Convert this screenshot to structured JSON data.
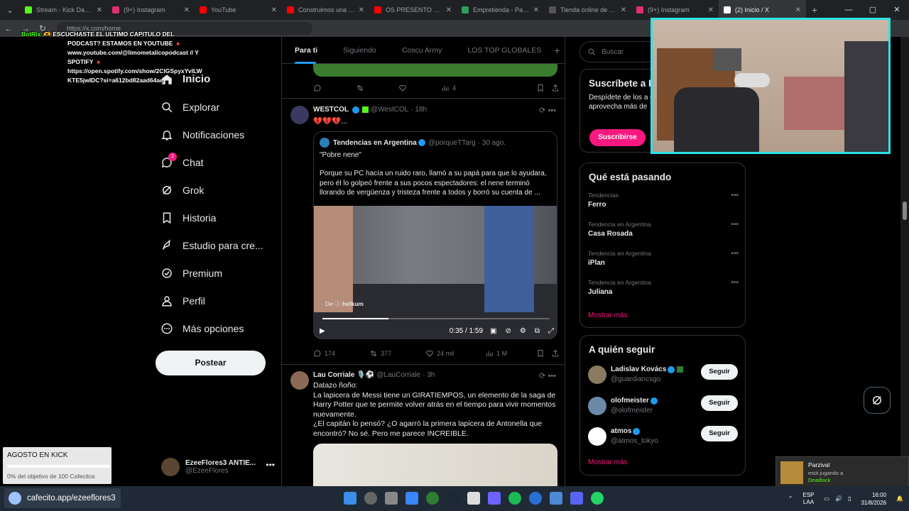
{
  "browser": {
    "tabs": [
      {
        "label": "Stream - Kick Dashboard",
        "color": "#53fc18"
      },
      {
        "label": "(9+) Instagram",
        "color": "#e1306c"
      },
      {
        "label": "YouTube",
        "color": "#ff0000"
      },
      {
        "label": "Construimos una estación",
        "color": "#ff0000"
      },
      {
        "label": "OS PRESENTO a SISI 🤗",
        "color": "#ff0000"
      },
      {
        "label": "Empretienda - Panel de",
        "color": "#2e9e5b"
      },
      {
        "label": "Tienda online de Sorali",
        "color": "#333333"
      },
      {
        "label": "(9+) Instagram",
        "color": "#e1306c"
      },
      {
        "label": "(2) Inicio / X",
        "color": "#ffffff"
      }
    ],
    "url": "https://x.com/home"
  },
  "chat_overlay": {
    "bot_name": "BotRix",
    "message_lines": [
      "🫶 ESCUCHASTE EL ULTIMO CAPITULO DEL",
      "PODCAST? ESTAMOS EN YOUTUBE 🔺",
      "www.youtube.com/@limometalicopodcast // Y",
      "SPOTIFY 🔺",
      "https://open.spotify.com/show/2ClGSpyxYvlLW",
      "KTE5jwIDC?si=a612bd82aad64ae"
    ]
  },
  "nav": {
    "items": [
      {
        "label": "Inicio",
        "icon": "home-icon"
      },
      {
        "label": "Explorar",
        "icon": "search-icon"
      },
      {
        "label": "Notificaciones",
        "icon": "bell-icon"
      },
      {
        "label": "Chat",
        "icon": "chat-icon",
        "badge": "2"
      },
      {
        "label": "Grok",
        "icon": "grok-icon"
      },
      {
        "label": "Historia",
        "icon": "bookmark-icon"
      },
      {
        "label": "Estudio para cre...",
        "icon": "rocket-icon"
      },
      {
        "label": "Premium",
        "icon": "premium-icon"
      },
      {
        "label": "Perfil",
        "icon": "person-icon"
      },
      {
        "label": "Más opciones",
        "icon": "more-circle-icon"
      }
    ],
    "post_button": "Postear"
  },
  "profile": {
    "name": "EzeeFlores3 ANTIE...",
    "handle": "@EzeeFlores"
  },
  "feed": {
    "tabs": [
      "Para ti",
      "Siguiendo",
      "Coscu Army",
      "LOS TOP GLOBALES"
    ],
    "prev_actions": {
      "views": "4"
    },
    "tweet1": {
      "name": "WESTCOL",
      "handle": "@WestCOL",
      "time": "· 18h",
      "text": "💔💔💔...",
      "quote": {
        "name": "Tendencias en Argentina",
        "handle": "@porqueTTarg",
        "time": "· 30 ago.",
        "line1": "\"Pobre nene\"",
        "body": "Porque su PC hacía un ruido raro, llamó a su papá para que lo ayudara, pero él lo golpeó frente a sus pocos espectadores: el nene terminó llorando de vergüenza y tristeza frente a todos y borró su cuenta de ...",
        "video_credit_prefix": "De",
        "video_credit_user": "helkum",
        "video_time": "0:35 / 1:59",
        "video_progress": 0.29
      },
      "replies": "174",
      "reposts": "377",
      "likes": "24 mil",
      "views": "1 M"
    },
    "tweet2": {
      "name": "Lau Corriale",
      "emojis": "🎙️⚽",
      "handle": "@LauCorriale",
      "time": "· 3h",
      "lines": [
        "Datazo ñoño:",
        "La lapicera de Messi tiene un GIRATIEMPOS, un elemento de la saga de Harry Potter que te permite volver atrás en el tiempo para vivir momentos nuevamente.",
        "¿El capitán lo pensó? ¿O agarró la primera lapicera de Antonella que encontró? No sé. Pero me parece INCREIBLE."
      ]
    }
  },
  "sidebar": {
    "search_placeholder": "Buscar",
    "subscribe": {
      "title": "Suscríbete a P",
      "text": "Despídete de los a estadísticas, aplica aprovecha más de",
      "button": "Suscribirse"
    },
    "trends_title": "Qué está pasando",
    "trends": [
      {
        "context": "Tendencias",
        "topic": "Ferro"
      },
      {
        "context": "Tendencia en Argentina",
        "topic": "Casa Rosada"
      },
      {
        "context": "Tendencia en Argentina",
        "topic": "iPlan"
      },
      {
        "context": "Tendencia en Argentina",
        "topic": "Juliana"
      }
    ],
    "show_more": "Mostrar más",
    "who_title": "A quién seguir",
    "who": [
      {
        "name": "Ladislav Kovács",
        "handle": "@guardiancsgo",
        "button": "Seguir"
      },
      {
        "name": "olofmeister",
        "handle": "@olofmeister",
        "button": "Seguir"
      },
      {
        "name": "atmos",
        "handle": "@atmos_tokyo",
        "button": "Seguir"
      }
    ],
    "who_more": "Mostrar más"
  },
  "stream_overlay": {
    "goal_title": "AGOSTO EN KICK",
    "goal_progress": 0,
    "goal_text": "0% del objetivo de 100 Cafecitos",
    "cafecito": "cafecito.app/ezeeflores3"
  },
  "notification": {
    "name": "Parzival",
    "status": "está jugando a",
    "game": "Deadlock"
  },
  "taskbar": {
    "lang1": "ESP",
    "lang2": "LAA",
    "time": "16:00",
    "date": "31/8/2026"
  }
}
